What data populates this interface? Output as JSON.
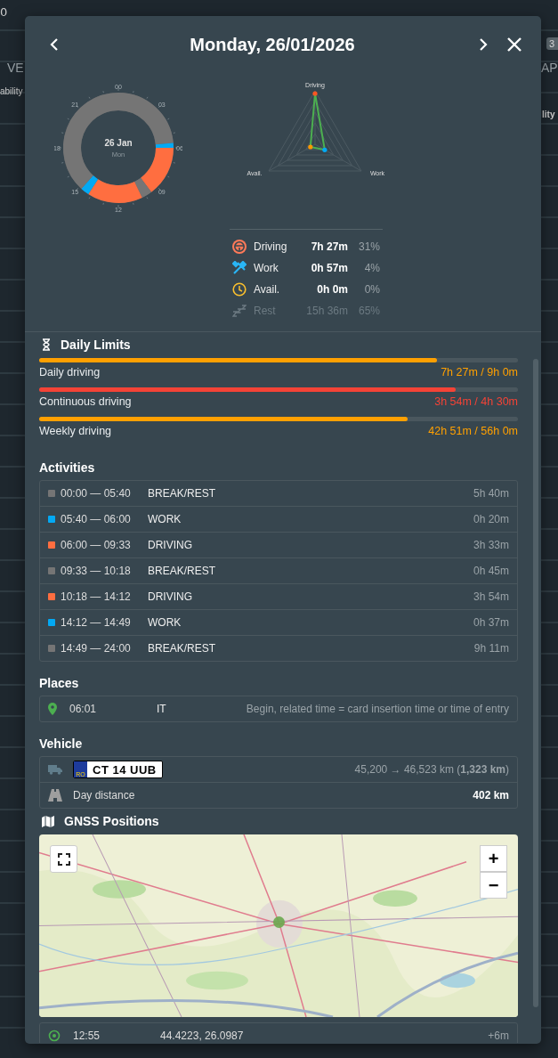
{
  "background": {
    "texts": [
      "0",
      "VE",
      "ability",
      "AP",
      "lity"
    ],
    "badge": "3"
  },
  "dialog": {
    "title": "Monday, 26/01/2026"
  },
  "day_ring": {
    "date": "26 Jan",
    "weekday": "Mon",
    "hours": [
      "00",
      "03",
      "06",
      "09",
      "12",
      "15",
      "18",
      "21"
    ]
  },
  "radar": {
    "axes": [
      "Driving",
      "Work",
      "Avail."
    ]
  },
  "summary": [
    {
      "kind": "driving",
      "label": "Driving",
      "duration": "7h 27m",
      "share": "31%",
      "disabled": false
    },
    {
      "kind": "work",
      "label": "Work",
      "duration": "0h 57m",
      "share": "4%",
      "disabled": false
    },
    {
      "kind": "avail",
      "label": "Avail.",
      "duration": "0h 0m",
      "share": "0%",
      "disabled": false
    },
    {
      "kind": "rest",
      "label": "Rest",
      "duration": "15h 36m",
      "share": "65%",
      "disabled": true
    }
  ],
  "daily_limits": {
    "title": "Daily Limits",
    "items": [
      {
        "label": "Daily driving",
        "reading": "7h 27m / 9h 0m",
        "level": 0.83,
        "color": "#ffa000"
      },
      {
        "label": "Continuous driving",
        "reading": "3h 54m / 4h 30m",
        "level": 0.87,
        "color": "#f44336"
      },
      {
        "label": "Weekly driving",
        "reading": "42h 51m / 56h 0m",
        "level": 0.77,
        "color": "#ffa000"
      }
    ]
  },
  "activities": {
    "title": "Activities",
    "rows": [
      {
        "time": "00:00 — 05:40",
        "type": "BREAK/REST",
        "duration": "5h 40m",
        "color": "#757575"
      },
      {
        "time": "05:40 — 06:00",
        "type": "WORK",
        "duration": "0h 20m",
        "color": "#03a9f4"
      },
      {
        "time": "06:00 — 09:33",
        "type": "DRIVING",
        "duration": "3h 33m",
        "color": "#ff6e40"
      },
      {
        "time": "09:33 — 10:18",
        "type": "BREAK/REST",
        "duration": "0h 45m",
        "color": "#757575"
      },
      {
        "time": "10:18 — 14:12",
        "type": "DRIVING",
        "duration": "3h 54m",
        "color": "#ff6e40"
      },
      {
        "time": "14:12 — 14:49",
        "type": "WORK",
        "duration": "0h 37m",
        "color": "#03a9f4"
      },
      {
        "time": "14:49 — 24:00",
        "type": "BREAK/REST",
        "duration": "9h 11m",
        "color": "#757575"
      }
    ]
  },
  "places": {
    "title": "Places",
    "rows": [
      {
        "time": "06:01",
        "country": "IT",
        "description": "Begin, related time = card insertion time or time of entry"
      }
    ]
  },
  "vehicle": {
    "title": "Vehicle",
    "plate_country": "RO",
    "plate": "CT 14 UUB",
    "odometer": "45,200 → 46,523 km (**1,323 km**)",
    "distance_label": "Day distance",
    "distance": "402 km"
  },
  "gnss": {
    "title": "GNSS Positions",
    "map": {
      "kind": "picture",
      "zoom_in": "+",
      "zoom_out": "−"
    },
    "rows": [
      {
        "time": "12:55",
        "position": "44.4223, 26.0987",
        "offset": "+6m"
      }
    ]
  }
}
